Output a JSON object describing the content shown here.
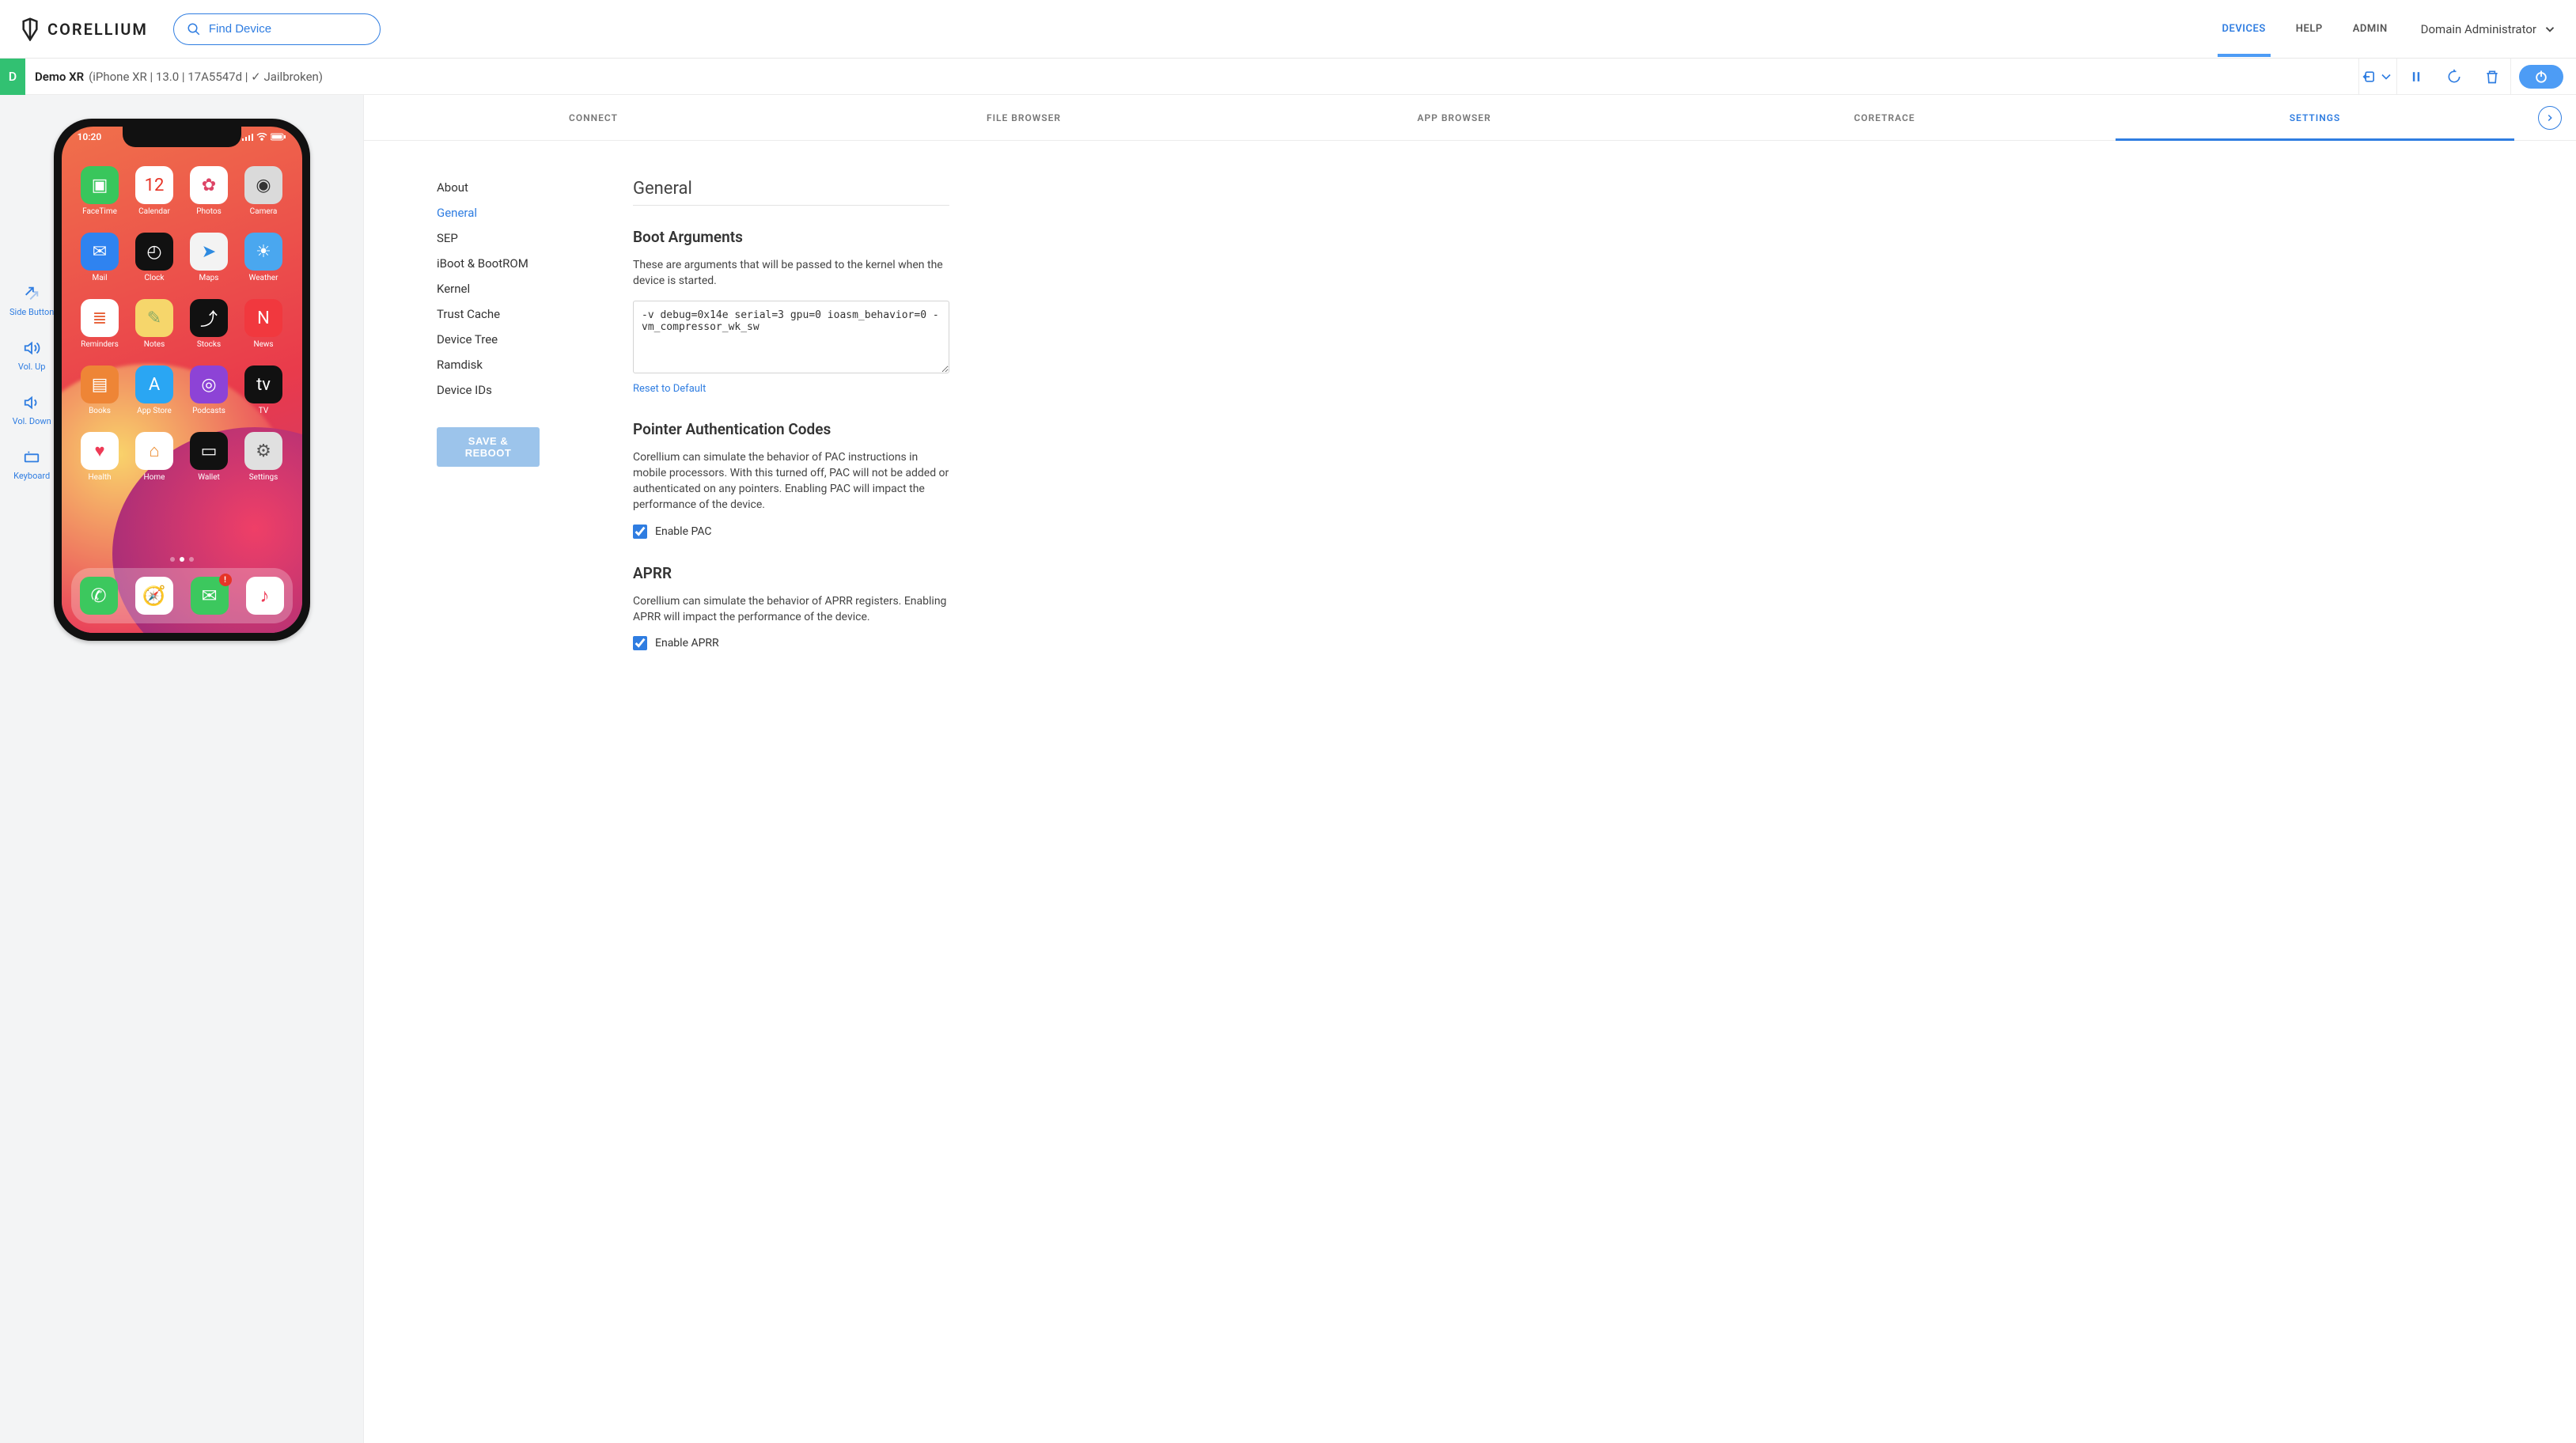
{
  "brand": "CORELLIUM",
  "search": {
    "placeholder": "Find Device"
  },
  "nav": {
    "devices": "DEVICES",
    "help": "HELP",
    "admin": "ADMIN"
  },
  "user": {
    "label": "Domain Administrator"
  },
  "device": {
    "letter": "D",
    "name": "Demo XR",
    "details": "(iPhone XR | 13.0 | 17A5547d | ✓ Jailbroken)"
  },
  "phoneControls": {
    "side": "Side Button",
    "volUp": "Vol. Up",
    "volDown": "Vol. Down",
    "keyboard": "Keyboard"
  },
  "phoneStatus": {
    "time": "10:20"
  },
  "phoneApps": [
    {
      "label": "FaceTime",
      "bg": "#39c65c",
      "glyph": "▣"
    },
    {
      "label": "Calendar",
      "bg": "#ffffff",
      "glyph": "12",
      "text": "#e73427"
    },
    {
      "label": "Photos",
      "bg": "#ffffff",
      "glyph": "✿",
      "text": "#d46"
    },
    {
      "label": "Camera",
      "bg": "#dadada",
      "glyph": "◉",
      "text": "#333"
    },
    {
      "label": "Mail",
      "bg": "#2f83f0",
      "glyph": "✉"
    },
    {
      "label": "Clock",
      "bg": "#111",
      "glyph": "◴"
    },
    {
      "label": "Maps",
      "bg": "#f3f3f3",
      "glyph": "➤",
      "text": "#2d8ae0"
    },
    {
      "label": "Weather",
      "bg": "#4aa7ef",
      "glyph": "☀"
    },
    {
      "label": "Reminders",
      "bg": "#ffffff",
      "glyph": "≣",
      "text": "#e8663f"
    },
    {
      "label": "Notes",
      "bg": "#f6d66b",
      "glyph": "✎",
      "text": "#8a6"
    },
    {
      "label": "Stocks",
      "bg": "#111",
      "glyph": "⤴"
    },
    {
      "label": "News",
      "bg": "#f1383e",
      "glyph": "N"
    },
    {
      "label": "Books",
      "bg": "#ee8536",
      "glyph": "▤"
    },
    {
      "label": "App Store",
      "bg": "#2aa6f3",
      "glyph": "A"
    },
    {
      "label": "Podcasts",
      "bg": "#8d43d6",
      "glyph": "◎"
    },
    {
      "label": "TV",
      "bg": "#111",
      "glyph": "tv"
    },
    {
      "label": "Health",
      "bg": "#ffffff",
      "glyph": "♥",
      "text": "#ee3a56"
    },
    {
      "label": "Home",
      "bg": "#ffffff",
      "glyph": "⌂",
      "text": "#eb8b2e"
    },
    {
      "label": "Wallet",
      "bg": "#111",
      "glyph": "▭"
    },
    {
      "label": "Settings",
      "bg": "#e0e0e0",
      "glyph": "⚙",
      "text": "#555"
    }
  ],
  "dockApps": [
    {
      "name": "Phone",
      "bg": "#3cc85e",
      "glyph": "✆"
    },
    {
      "name": "Safari",
      "bg": "#ffffff",
      "glyph": "🧭"
    },
    {
      "name": "Messages",
      "bg": "#3cc85e",
      "glyph": "✉",
      "badge": "!"
    },
    {
      "name": "Music",
      "bg": "#ffffff",
      "glyph": "♪",
      "text": "#ee3a56"
    }
  ],
  "rightTabs": {
    "connect": "CONNECT",
    "file": "FILE BROWSER",
    "app": "APP BROWSER",
    "coretrace": "CORETRACE",
    "settings": "SETTINGS"
  },
  "sidemenu": {
    "about": "About",
    "general": "General",
    "sep": "SEP",
    "iboot": "iBoot & BootROM",
    "kernel": "Kernel",
    "trust": "Trust Cache",
    "dtree": "Device Tree",
    "ramdisk": "Ramdisk",
    "dids": "Device IDs",
    "save": "SAVE & REBOOT"
  },
  "settings": {
    "title": "General",
    "boot": {
      "heading": "Boot Arguments",
      "desc": "These are arguments that will be passed to the kernel when the device is started.",
      "value": "-v debug=0x14e serial=3 gpu=0 ioasm_behavior=0 -vm_compressor_wk_sw",
      "reset": "Reset to Default"
    },
    "pac": {
      "heading": "Pointer Authentication Codes",
      "desc": "Corellium can simulate the behavior of PAC instructions in mobile processors. With this turned off, PAC will not be added or authenticated on any pointers. Enabling PAC will impact the performance of the device.",
      "label": "Enable PAC"
    },
    "aprr": {
      "heading": "APRR",
      "desc": "Corellium can simulate the behavior of APRR registers. Enabling APRR will impact the performance of the device.",
      "label": "Enable APRR"
    }
  }
}
